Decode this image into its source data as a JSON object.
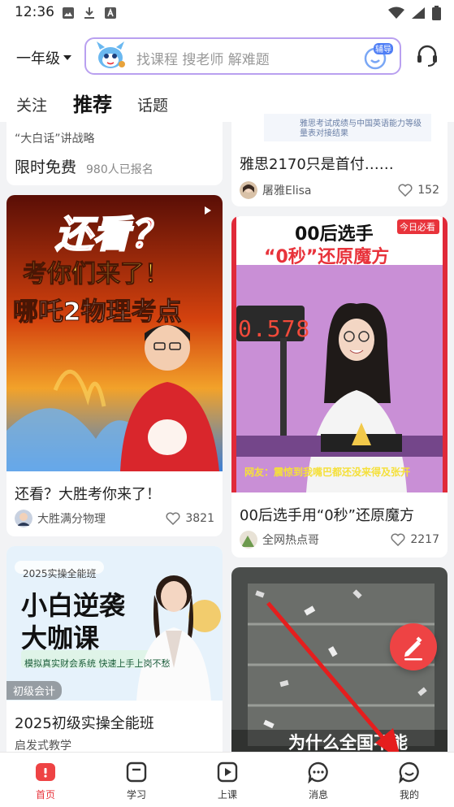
{
  "status_bar": {
    "time": "12:36"
  },
  "header": {
    "grade_label": "一年级",
    "search_placeholder": "找课程 搜老师 解难题",
    "tutor_badge": "辅导"
  },
  "tabs": [
    {
      "label": "关注"
    },
    {
      "label": "推荐"
    },
    {
      "label": "话题"
    }
  ],
  "feed_left": [
    {
      "subtitle": "“大白话”讲战略",
      "title": "限时免费",
      "enrolled": "980人已报名"
    },
    {
      "image_text_line1": "还看？",
      "image_text_line2": "考你们来了！",
      "image_text_line3": "哪吒2物理考点",
      "title": "还看？大胜考你来了！",
      "author": "大胜满分物理",
      "likes": "3821"
    },
    {
      "image_badge": "2025实操全能班",
      "image_headline1": "小白逆袭",
      "image_headline2": "大咖课",
      "image_tagline": "模拟真实财会系统  快速上手上岗不愁",
      "category_tag": "初级会计",
      "title": "2025初级实操全能班",
      "author": "启发式教学"
    }
  ],
  "feed_right": [
    {
      "image_caption": "雅思考试成绩与中国英语能力等级量表对接结果",
      "title": "雅思2170只是首付……",
      "author": "屠雅Elisa",
      "likes": "152"
    },
    {
      "image_title1": "00后选手",
      "image_title2": "“0秒”还原魔方",
      "image_badge": "今日必看",
      "image_timer": "0.578",
      "image_subtitle": "网友：震惊到我嘴巴都还没来得及张开",
      "title": "00后选手用“0秒”还原魔方",
      "author": "全网热点哥",
      "likes": "2217"
    },
    {
      "image_caption": "为什么全国不能"
    }
  ],
  "bottom_nav": [
    {
      "label": "首页"
    },
    {
      "label": "学习"
    },
    {
      "label": "上课"
    },
    {
      "label": "消息"
    },
    {
      "label": "我的"
    }
  ],
  "colors": {
    "accent": "#e8333b",
    "search_border": "#b9a0f0",
    "background": "#f2f3f5"
  }
}
